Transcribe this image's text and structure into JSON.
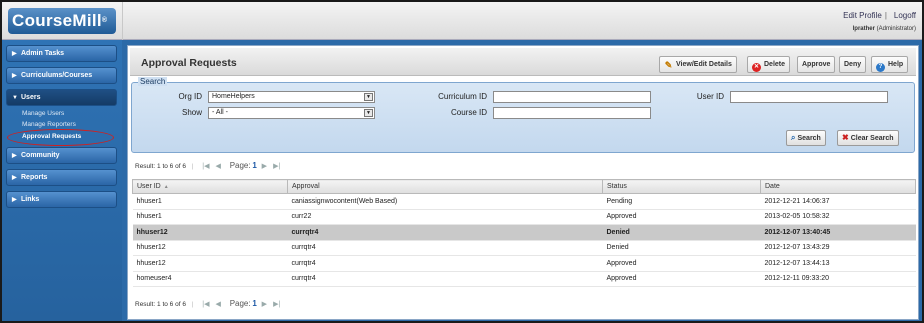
{
  "app": {
    "logo_text": "CourseMill",
    "logo_mark": "®"
  },
  "topbar": {
    "edit_profile": "Edit Profile",
    "separator": "|",
    "logoff": "Logoff",
    "username": "lprather",
    "role": "(Administrator)"
  },
  "sidebar": {
    "items": [
      {
        "label": "Admin Tasks",
        "arrow": "▶"
      },
      {
        "label": "Curriculums/Courses",
        "arrow": "▶"
      },
      {
        "label": "Users",
        "arrow": "▼"
      },
      {
        "label": "Community",
        "arrow": "▶"
      },
      {
        "label": "Reports",
        "arrow": "▶"
      },
      {
        "label": "Links",
        "arrow": "▶"
      }
    ],
    "users_sub": [
      "Manage Users",
      "Manage Reporters",
      "Approval Requests"
    ]
  },
  "header": {
    "title": "Approval Requests",
    "buttons": {
      "view_edit": "View/Edit Details",
      "delete": "Delete",
      "approve": "Approve",
      "deny": "Deny",
      "help": "Help"
    }
  },
  "search": {
    "legend": "Search",
    "org_id_label": "Org ID",
    "org_id_value": "HomeHelpers",
    "show_label": "Show",
    "show_value": "- All -",
    "curriculum_id_label": "Curriculum ID",
    "curriculum_id_value": "",
    "course_id_label": "Course ID",
    "course_id_value": "",
    "user_id_label": "User ID",
    "user_id_value": "",
    "search_button": "Search",
    "clear_button": "Clear Search"
  },
  "pager": {
    "result_text": "Result: 1 to 6 of 6",
    "page_label": "Page:",
    "page_number": "1"
  },
  "table": {
    "columns": [
      "User ID",
      "Approval",
      "Status",
      "Date"
    ],
    "rows": [
      {
        "user_id": "hhuser1",
        "approval": "caniassignwocontent(Web Based)",
        "status": "Pending",
        "date": "2012-12-21 14:06:37"
      },
      {
        "user_id": "hhuser1",
        "approval": "curr22",
        "status": "Approved",
        "date": "2013-02-05 10:58:32"
      },
      {
        "user_id": "hhuser12",
        "approval": "currqtr4",
        "status": "Denied",
        "date": "2012-12-07 13:40:45"
      },
      {
        "user_id": "hhuser12",
        "approval": "currqtr4",
        "status": "Denied",
        "date": "2012-12-07 13:43:29"
      },
      {
        "user_id": "hhuser12",
        "approval": "currqtr4",
        "status": "Approved",
        "date": "2012-12-07 13:44:13"
      },
      {
        "user_id": "homeuser4",
        "approval": "currqtr4",
        "status": "Approved",
        "date": "2012-12-11 09:33:20"
      }
    ],
    "selected_row": 2
  },
  "colors": {
    "brand_blue": "#2c6aa8",
    "annotation_red": "#cc2222"
  }
}
